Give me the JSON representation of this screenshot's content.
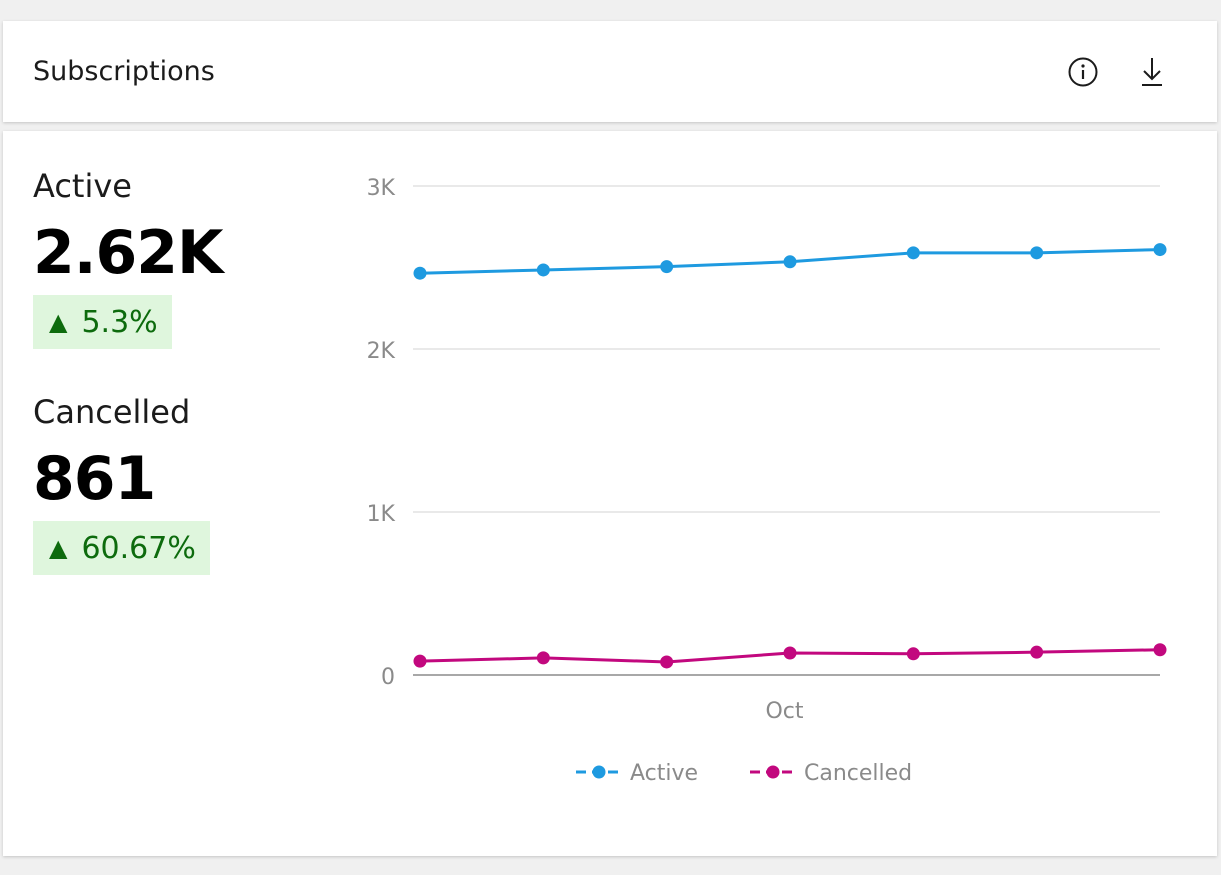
{
  "header": {
    "title": "Subscriptions",
    "icons": [
      "info-icon",
      "download-icon"
    ]
  },
  "metrics": [
    {
      "label": "Active",
      "value": "2.62K",
      "change": "5.3%",
      "trend": "up"
    },
    {
      "label": "Cancelled",
      "value": "861",
      "change": "60.67%",
      "trend": "up"
    }
  ],
  "colors": {
    "active": "#1e9ae0",
    "cancelled": "#c2087e",
    "badge_bg": "#dff6dd",
    "badge_text": "#0d6b0d"
  },
  "chart_data": {
    "type": "line",
    "x": [
      1,
      2,
      3,
      4,
      5,
      6,
      7
    ],
    "xlabel": "Oct",
    "ylim": [
      0,
      3000
    ],
    "yticks": [
      0,
      1000,
      2000,
      3000
    ],
    "ytick_labels": [
      "0",
      "1K",
      "2K",
      "3K"
    ],
    "grid": true,
    "legend": "bottom",
    "series": [
      {
        "name": "Active",
        "color": "#1e9ae0",
        "values": [
          2465,
          2485,
          2505,
          2535,
          2590,
          2590,
          2610
        ]
      },
      {
        "name": "Cancelled",
        "color": "#c2087e",
        "values": [
          85,
          105,
          80,
          135,
          130,
          140,
          155
        ]
      }
    ]
  }
}
